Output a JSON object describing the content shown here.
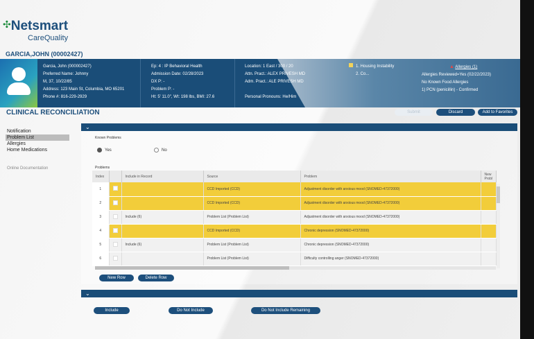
{
  "brand": {
    "name": "Netsmart",
    "sub": "CareQuality"
  },
  "patient_header": "GARCIA,JOHN (00002427)",
  "banner": {
    "col1": [
      "Garcia, John (000002427)",
      "Preferred Name: Johnny",
      "M, 37, 10/22/85",
      "Address: 123 Main St, Columbia, MO 65201",
      "Phone #: 816-229-2929"
    ],
    "col2": [
      "Ep: 4 : IP Behavioral Health",
      "Admission Date: 02/28/2023",
      "DX P: -",
      "Problem P: -",
      "Ht: 5' 11.0\", Wt: 198 lbs, BMI: 27.6"
    ],
    "col3": [
      "Location: 1 East / 300 / 20",
      "Attn. Pract.: ALEX PRIVESH MD",
      "Adm. Pract.: ALE PRIVESH MD",
      "",
      "Personal Pronouns: He/Him"
    ],
    "flags": [
      "1. Housing Instability",
      "2. Co..."
    ],
    "allergies_link": "Allergies (1)",
    "allergies": [
      "Allergies Reviewed=Yes (02/22/2023)",
      "No Known Food Allergies",
      "1) PCN (penicillin) - Confirmed"
    ]
  },
  "page_title": "CLINICAL RECONCILIATION",
  "actions": {
    "submit": "Submit",
    "discard": "Discard",
    "favorites": "Add to Favorites"
  },
  "nav": {
    "items": [
      "Notification",
      "Problem List",
      "Allergies",
      "Home Medications"
    ],
    "online": "Online Documentation"
  },
  "known_problems": {
    "label": "Known Problems",
    "yes": "Yes",
    "no": "No"
  },
  "problems": {
    "label": "Problems",
    "columns": [
      "Index",
      "",
      "Include in Record",
      "Source",
      "Problem",
      "New Probl"
    ],
    "rows": [
      {
        "index": "1",
        "include": "",
        "source": "CCD Imported (CCD)",
        "problem": "Adjustment disorder with anxious mood (SNOMED-47372000)"
      },
      {
        "index": "2",
        "include": "",
        "source": "CCD Imported (CCD)",
        "problem": "Adjustment disorder with anxious mood (SNOMED-47372000)"
      },
      {
        "index": "3",
        "include": "Include (6)",
        "source": "Problem List (Problem List)",
        "problem": "Adjustment disorder with anxious mood (SNOMED-47372000)"
      },
      {
        "index": "4",
        "include": "",
        "source": "CCD Imported (CCD)",
        "problem": "Chronic depression (SNOMED-47372000)"
      },
      {
        "index": "5",
        "include": "Include (6)",
        "source": "Problem List (Problem List)",
        "problem": "Chronic depression (SNOMED-47372000)"
      },
      {
        "index": "6",
        "include": "",
        "source": "Problem List (Problem List)",
        "problem": "Difficulty controlling anger (SNOMED-47372000)"
      }
    ],
    "new_row": "New Row",
    "delete_row": "Delete Row"
  },
  "bottom": {
    "include": "Include",
    "do_not_include": "Do Not Include",
    "do_not_include_remaining": "Do Not Include Remaining"
  }
}
